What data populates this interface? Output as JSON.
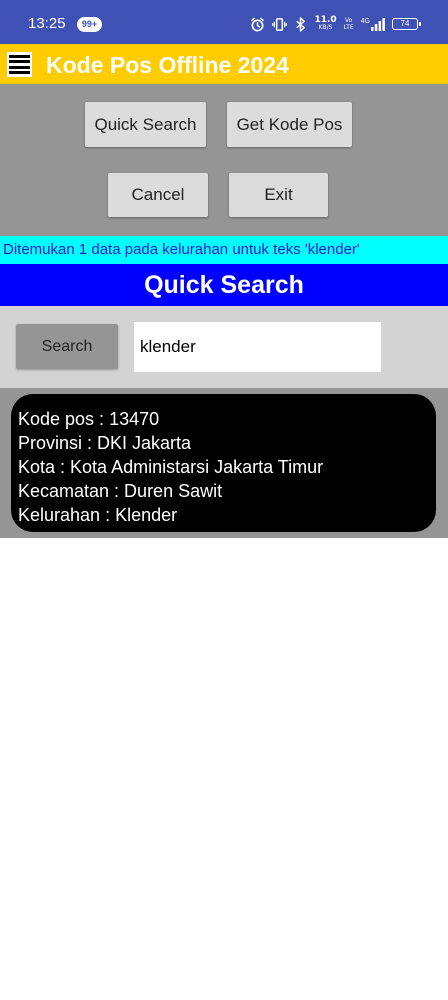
{
  "status_bar": {
    "time": "13:25",
    "notification_badge": "99+",
    "net_speed_value": "11.0",
    "net_speed_unit": "KB/S",
    "volte_label": "Vo LTE",
    "signal_label": "4G",
    "battery_level": "74",
    "background_color": "#3f51b5"
  },
  "app_bar": {
    "title": "Kode Pos Offline 2024",
    "background_color": "#ffcc00"
  },
  "buttons": {
    "quick_search": "Quick Search",
    "get_kode_pos": "Get Kode Pos",
    "cancel": "Cancel",
    "exit": "Exit"
  },
  "status_message": {
    "text": "Ditemukan 1 data pada kelurahan untuk teks 'klender'",
    "background_color": "#00ffff",
    "text_color": "#1a1ad6"
  },
  "section_header": {
    "title": "Quick Search",
    "background_color": "#0000ff"
  },
  "search": {
    "button_label": "Search",
    "input_value": "klender"
  },
  "result": {
    "lines": [
      "Kode pos : 13470",
      "Provinsi : DKI Jakarta",
      "Kota : Kota Administarsi Jakarta Timur",
      "Kecamatan : Duren Sawit",
      "Kelurahan : Klender"
    ]
  }
}
